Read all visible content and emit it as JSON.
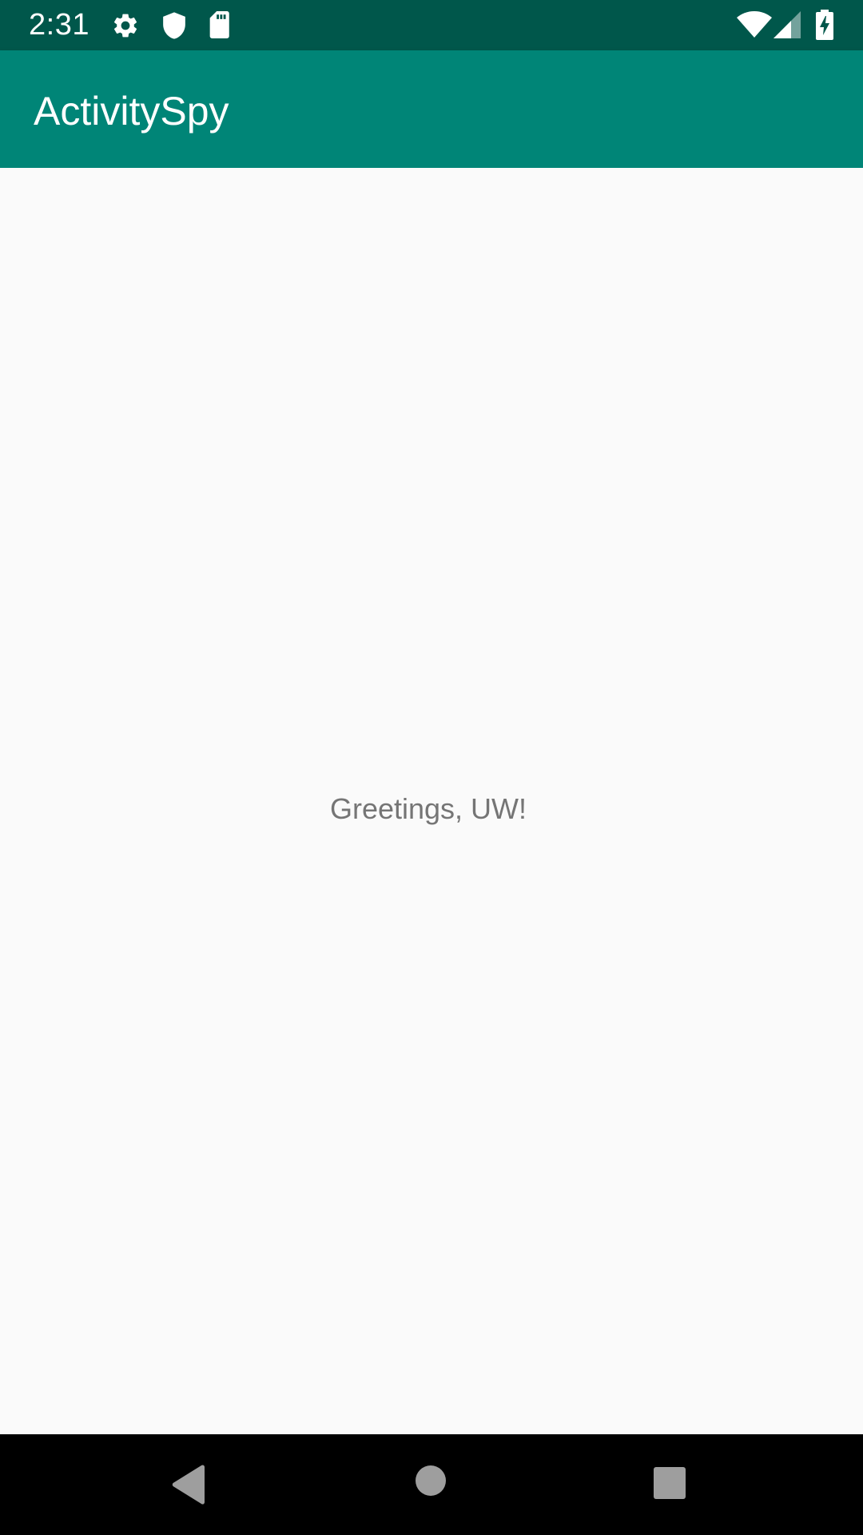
{
  "status_bar": {
    "time": "2:31",
    "left_icons": [
      "gear-icon",
      "shield-icon",
      "sd-card-icon"
    ],
    "right_icons": [
      "wifi-icon",
      "cell-signal-icon",
      "battery-charging-icon"
    ],
    "background_color": "#00574B"
  },
  "app_bar": {
    "title": "ActivitySpy",
    "background_color": "#008577"
  },
  "main": {
    "greeting_text": "Greetings, UW!",
    "background_color": "#FAFAFA",
    "text_color": "#757575"
  },
  "nav_bar": {
    "buttons": [
      "back-icon",
      "home-icon",
      "recents-icon"
    ],
    "background_color": "#000000"
  }
}
